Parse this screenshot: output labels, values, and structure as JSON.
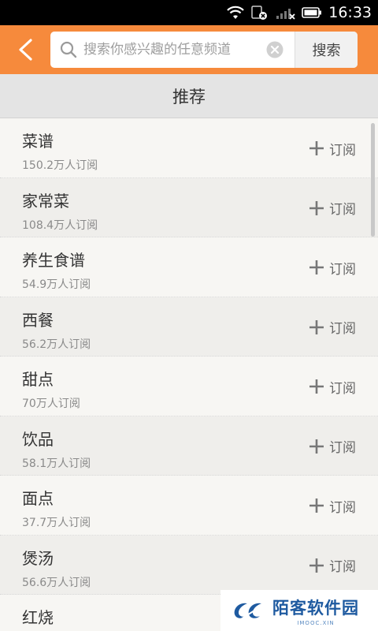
{
  "status_bar": {
    "time": "16:33",
    "icons": [
      "wifi-icon",
      "sim-disabled-icon",
      "signal-off-icon",
      "battery-icon"
    ]
  },
  "header": {
    "back_icon": "chevron-left-icon",
    "search": {
      "placeholder": "搜索你感兴趣的任意频道",
      "value": "",
      "clear_icon": "clear-circle-icon",
      "button_label": "搜索"
    },
    "accent_color": "#f68a3c"
  },
  "section": {
    "title": "推荐"
  },
  "channels": [
    {
      "name": "菜谱",
      "subscribers": "150.2万人订阅",
      "action": "订阅"
    },
    {
      "name": "家常菜",
      "subscribers": "108.4万人订阅",
      "action": "订阅"
    },
    {
      "name": "养生食谱",
      "subscribers": "54.9万人订阅",
      "action": "订阅"
    },
    {
      "name": "西餐",
      "subscribers": "56.2万人订阅",
      "action": "订阅"
    },
    {
      "name": "甜点",
      "subscribers": "70万人订阅",
      "action": "订阅"
    },
    {
      "name": "饮品",
      "subscribers": "58.1万人订阅",
      "action": "订阅"
    },
    {
      "name": "面点",
      "subscribers": "37.7万人订阅",
      "action": "订阅"
    },
    {
      "name": "煲汤",
      "subscribers": "56.6万人订阅",
      "action": "订阅"
    },
    {
      "name": "红烧",
      "subscribers": "",
      "action": ""
    }
  ],
  "watermark": {
    "title": "陌客软件园",
    "subtitle": "IMOOC.XIN"
  }
}
